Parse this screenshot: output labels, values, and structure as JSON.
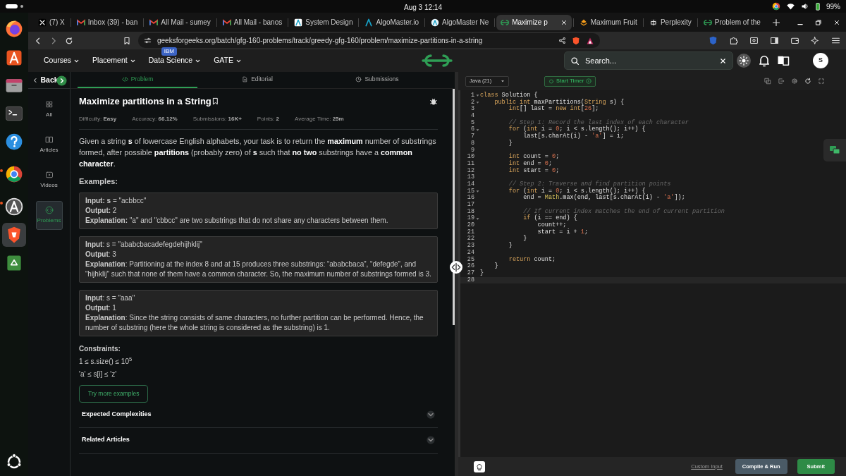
{
  "top_bar": {
    "clock": "Aug 3  12:14",
    "battery": "99%"
  },
  "dock": {
    "apps": [
      {
        "kind": "firefox",
        "running": false,
        "selected": false
      },
      {
        "kind": "store",
        "running": false,
        "selected": false
      },
      {
        "kind": "files",
        "running": false,
        "selected": false
      },
      {
        "kind": "terminal",
        "running": false,
        "selected": false
      },
      {
        "kind": "help",
        "running": false,
        "selected": false
      },
      {
        "kind": "chrome",
        "running": true,
        "selected": false
      },
      {
        "kind": "updater",
        "running": true,
        "selected": false
      },
      {
        "kind": "brave",
        "running": false,
        "selected": true
      },
      {
        "kind": "trash",
        "running": false,
        "selected": false
      }
    ]
  },
  "browser": {
    "tabs": [
      {
        "title": "(7) X",
        "kind": "x",
        "selected": false
      },
      {
        "title": "Inbox (39) - ban",
        "kind": "mail",
        "selected": false
      },
      {
        "title": "All Mail - sumey",
        "kind": "mail",
        "selected": false
      },
      {
        "title": "All Mail - banos",
        "kind": "mail",
        "selected": false
      },
      {
        "title": "System Design",
        "kind": "alight",
        "selected": false
      },
      {
        "title": "AlgoMaster.io",
        "kind": "adark",
        "selected": false
      },
      {
        "title": "AlgoMaster Ne",
        "kind": "acircle",
        "selected": false
      },
      {
        "title": "Maximize p",
        "kind": "gfg",
        "selected": true
      },
      {
        "title": "Maximum Fruit",
        "kind": "fruit",
        "selected": false
      },
      {
        "title": "Perplexity",
        "kind": "perplexity",
        "selected": false
      },
      {
        "title": "Problem of the",
        "kind": "gfg",
        "selected": false
      }
    ],
    "url": "geeksforgeeks.org/batch/gfg-160-problems/track/greedy-gfg-160/problem/maximize-partitions-in-a-string"
  },
  "site_nav": {
    "menus": [
      {
        "label": "Courses"
      },
      {
        "label": "Placement"
      },
      {
        "label": "Data Science",
        "badge": "IBM"
      },
      {
        "label": "GATE"
      }
    ],
    "search": {
      "placeholder": "Search..."
    },
    "avatar": "S"
  },
  "sidebar": {
    "back": "Back",
    "items": [
      {
        "label": "All",
        "kind": "grid",
        "selected": false
      },
      {
        "label": "Articles",
        "kind": "book",
        "selected": false
      },
      {
        "label": "Videos",
        "kind": "video",
        "selected": false
      },
      {
        "label": "Problems",
        "kind": "code",
        "selected": true
      }
    ]
  },
  "problem_tabs": [
    {
      "label": "Problem",
      "kind": "code",
      "selected": true
    },
    {
      "label": "Editorial",
      "kind": "doc",
      "selected": false
    },
    {
      "label": "Submissions",
      "kind": "clock",
      "selected": false
    }
  ],
  "problem": {
    "title": "Maximize partitions in a String",
    "stats": [
      "Difficulty: **Easy**",
      "Accuracy: **66.12%**",
      "Submissions: **16K+**",
      "Points: **2**",
      "Average Time: **25m**"
    ],
    "description": "Given a string **s** of lowercase English alphabets, your task is to return the **maximum** number of substrings formed, after possible **partitions** (probably zero) of **s** such that **no two** substrings have a **common character**.",
    "examples_heading": "Examples:",
    "examples": [
      {
        "lines": [
          "**Input:** **s** = \"acbbcc\"",
          "**Output:** 2",
          "**Explanation:** \"a\" and \"cbbcc\" are two substrings that do not share any characters between them."
        ]
      },
      {
        "lines": [
          "**Input**: s = \"ababcbacadefegdehijhklij\"",
          "**Output**: 3",
          "**Explanation**: Partitioning at the index 8 and at 15 produces three substrings: “ababcbaca”, “defegde”, and “hijhklij” such that none of them have a common character. So, the maximum number of substrings formed is 3."
        ]
      },
      {
        "lines": [
          "**Input**: s = \"aaa\"",
          "**Output**: 1",
          "**Explanation**: Since the string consists of same characters, no further partition can be performed. Hence, the number of substring (here the whole string is considered as the substring) is 1."
        ]
      }
    ],
    "constraints_heading": "Constraints:",
    "constraints": [
      "1 ≤ s.size() ≤ 10$^{5}$",
      "'a' ≤ s[i] ≤ 'z'"
    ],
    "more_button": "Try more examples",
    "sections": [
      {
        "title": "Expected Complexities",
        "expanded": false
      },
      {
        "title": "Related Articles",
        "expanded": false
      }
    ]
  },
  "editor": {
    "language": "Java (21)",
    "timer_button": "Start Timer",
    "lines": [
      {
        "number": "1",
        "foldable": true,
        "current": false,
        "tokens": [
          {
            "kind": "keyword",
            "text": "class"
          },
          {
            "kind": "plain",
            "text": " Solution {"
          }
        ]
      },
      {
        "number": "2",
        "foldable": true,
        "current": false,
        "tokens": [
          {
            "kind": "keyword",
            "text": "    public int"
          },
          {
            "kind": "plain",
            "text": " maxPartitions("
          },
          {
            "kind": "keyword",
            "text": "String"
          },
          {
            "kind": "plain",
            "text": " s) {"
          }
        ]
      },
      {
        "number": "3",
        "foldable": false,
        "current": false,
        "tokens": [
          {
            "kind": "keyword",
            "text": "        int"
          },
          {
            "kind": "plain",
            "text": "[] last = "
          },
          {
            "kind": "keyword",
            "text": "new int"
          },
          {
            "kind": "plain",
            "text": "["
          },
          {
            "kind": "number",
            "text": "26"
          },
          {
            "kind": "plain",
            "text": "];"
          }
        ]
      },
      {
        "number": "4",
        "foldable": false,
        "current": false
      },
      {
        "number": "5",
        "foldable": false,
        "current": false,
        "tokens": [
          {
            "kind": "comment",
            "text": "        // Step 1: Record the last index of each character"
          }
        ]
      },
      {
        "number": "6",
        "foldable": true,
        "current": false,
        "tokens": [
          {
            "kind": "keyword",
            "text": "        for"
          },
          {
            "kind": "plain",
            "text": " ("
          },
          {
            "kind": "keyword",
            "text": "int"
          },
          {
            "kind": "plain",
            "text": " i = "
          },
          {
            "kind": "number",
            "text": "0"
          },
          {
            "kind": "plain",
            "text": "; i < s.length(); i++) {"
          }
        ]
      },
      {
        "number": "7",
        "foldable": false,
        "current": false,
        "tokens": [
          {
            "kind": "plain",
            "text": "            last[s.charAt(i) - "
          },
          {
            "kind": "string",
            "text": "'a'"
          },
          {
            "kind": "plain",
            "text": "] = i;"
          }
        ]
      },
      {
        "number": "8",
        "foldable": false,
        "current": false,
        "tokens": [
          {
            "kind": "plain",
            "text": "        }"
          }
        ]
      },
      {
        "number": "9",
        "foldable": false,
        "current": false
      },
      {
        "number": "10",
        "foldable": false,
        "current": false,
        "tokens": [
          {
            "kind": "keyword",
            "text": "        int"
          },
          {
            "kind": "plain",
            "text": " count = "
          },
          {
            "kind": "number",
            "text": "0"
          },
          {
            "kind": "plain",
            "text": ";"
          }
        ]
      },
      {
        "number": "11",
        "foldable": false,
        "current": false,
        "tokens": [
          {
            "kind": "keyword",
            "text": "        int"
          },
          {
            "kind": "plain",
            "text": " end = "
          },
          {
            "kind": "number",
            "text": "0"
          },
          {
            "kind": "plain",
            "text": ";"
          }
        ]
      },
      {
        "number": "12",
        "foldable": false,
        "current": false,
        "tokens": [
          {
            "kind": "keyword",
            "text": "        int"
          },
          {
            "kind": "plain",
            "text": " start = "
          },
          {
            "kind": "number",
            "text": "0"
          },
          {
            "kind": "plain",
            "text": ";"
          }
        ]
      },
      {
        "number": "13",
        "foldable": false,
        "current": false
      },
      {
        "number": "14",
        "foldable": false,
        "current": false,
        "tokens": [
          {
            "kind": "comment",
            "text": "        // Step 2: Traverse and find partition points"
          }
        ]
      },
      {
        "number": "15",
        "foldable": true,
        "current": false,
        "tokens": [
          {
            "kind": "keyword",
            "text": "        for"
          },
          {
            "kind": "plain",
            "text": " ("
          },
          {
            "kind": "keyword",
            "text": "int"
          },
          {
            "kind": "plain",
            "text": " i = "
          },
          {
            "kind": "number",
            "text": "0"
          },
          {
            "kind": "plain",
            "text": "; i < s.length(); i++) {"
          }
        ]
      },
      {
        "number": "16",
        "foldable": false,
        "current": false,
        "tokens": [
          {
            "kind": "plain",
            "text": "            end = "
          },
          {
            "kind": "type",
            "text": "Math"
          },
          {
            "kind": "plain",
            "text": ".max(end, last[s.charAt(i) - "
          },
          {
            "kind": "string",
            "text": "'a'"
          },
          {
            "kind": "plain",
            "text": "]);"
          }
        ]
      },
      {
        "number": "17",
        "foldable": false,
        "current": false
      },
      {
        "number": "18",
        "foldable": false,
        "current": false,
        "tokens": [
          {
            "kind": "comment",
            "text": "            // If current index matches the end of current partition"
          }
        ]
      },
      {
        "number": "19",
        "foldable": true,
        "current": false,
        "tokens": [
          {
            "kind": "keyword",
            "text": "            if"
          },
          {
            "kind": "plain",
            "text": " (i == end) {"
          }
        ]
      },
      {
        "number": "20",
        "foldable": false,
        "current": false,
        "tokens": [
          {
            "kind": "plain",
            "text": "                count++;"
          }
        ]
      },
      {
        "number": "21",
        "foldable": false,
        "current": false,
        "tokens": [
          {
            "kind": "plain",
            "text": "                start = i + "
          },
          {
            "kind": "number",
            "text": "1"
          },
          {
            "kind": "plain",
            "text": ";"
          }
        ]
      },
      {
        "number": "22",
        "foldable": false,
        "current": false,
        "tokens": [
          {
            "kind": "plain",
            "text": "            }"
          }
        ]
      },
      {
        "number": "23",
        "foldable": false,
        "current": false,
        "tokens": [
          {
            "kind": "plain",
            "text": "        }"
          }
        ]
      },
      {
        "number": "24",
        "foldable": false,
        "current": false
      },
      {
        "number": "25",
        "foldable": false,
        "current": false,
        "tokens": [
          {
            "kind": "keyword",
            "text": "        return"
          },
          {
            "kind": "plain",
            "text": " count;"
          }
        ]
      },
      {
        "number": "26",
        "foldable": false,
        "current": false,
        "tokens": [
          {
            "kind": "plain",
            "text": "    }"
          }
        ]
      },
      {
        "number": "27",
        "foldable": false,
        "current": false,
        "tokens": [
          {
            "kind": "plain",
            "text": "}"
          }
        ]
      },
      {
        "number": "28",
        "foldable": false,
        "current": true
      }
    ],
    "custom_input": "Custom Input",
    "run_button": "Compile & Run",
    "submit_button": "Submit"
  }
}
